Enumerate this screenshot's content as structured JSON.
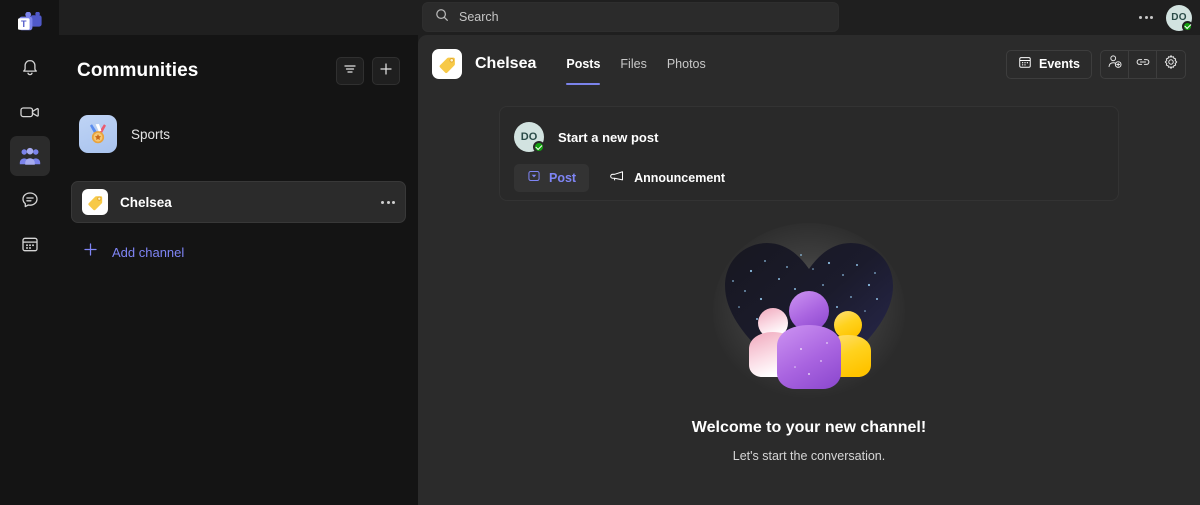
{
  "rail": {
    "items": [
      {
        "name": "teams-logo",
        "label": "Microsoft Teams"
      },
      {
        "name": "activity",
        "label": "Activity"
      },
      {
        "name": "meet",
        "label": "Meet"
      },
      {
        "name": "communities",
        "label": "Communities"
      },
      {
        "name": "chat",
        "label": "Chat"
      },
      {
        "name": "calendar",
        "label": "Calendar"
      }
    ]
  },
  "topbar": {
    "search": {
      "placeholder": "Search",
      "value": ""
    },
    "more_label": "",
    "avatar_initials": "DO"
  },
  "sidebar": {
    "title": "Communities",
    "filter_label": "",
    "add_label": "",
    "communities": [
      {
        "name": "Sports",
        "icon": "medal-icon"
      }
    ],
    "channels": [
      {
        "name": "Chelsea",
        "icon": "tag-icon",
        "selected": true
      }
    ],
    "add_channel_label": "Add channel"
  },
  "content": {
    "channel": {
      "title": "Chelsea",
      "icon": "tag-icon"
    },
    "tabs": [
      {
        "label": "Posts",
        "active": true
      },
      {
        "label": "Files",
        "active": false
      },
      {
        "label": "Photos",
        "active": false
      }
    ],
    "actions": {
      "events_label": "Events",
      "add_member_label": "",
      "link_label": "",
      "settings_label": ""
    },
    "composer": {
      "avatar_initials": "DO",
      "placeholder": "Start a new post",
      "post_label": "Post",
      "announcement_label": "Announcement"
    },
    "empty_state": {
      "title": "Welcome to your new channel!",
      "subtitle": "Let's start the conversation."
    }
  },
  "colors": {
    "accent": "#7b83eb",
    "link": "#7f85f5",
    "rail_bg": "#141414",
    "sidebar_bg": "#141414",
    "content_bg": "#2b2b2b",
    "presence_online": "#13a10e"
  }
}
